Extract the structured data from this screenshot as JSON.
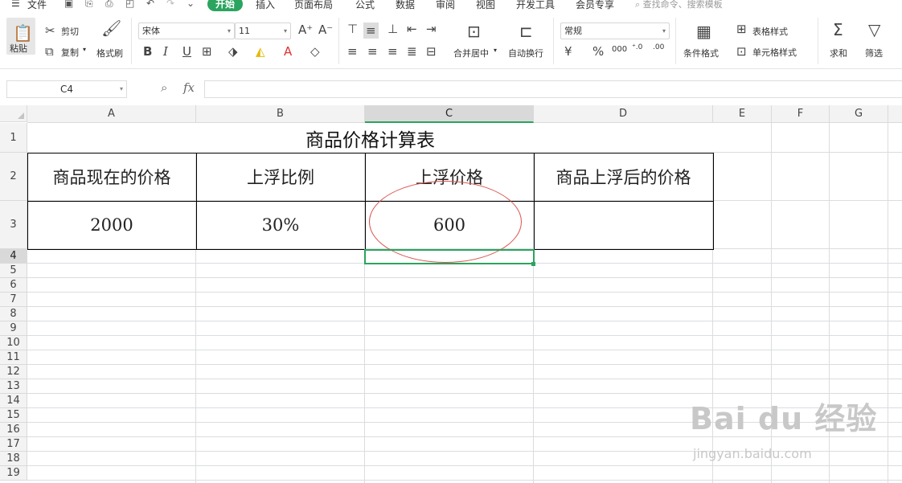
{
  "menu": {
    "file_label": "文件",
    "tabs": [
      {
        "label": "开始",
        "active": true
      },
      {
        "label": "插入"
      },
      {
        "label": "页面布局"
      },
      {
        "label": "公式"
      },
      {
        "label": "数据"
      },
      {
        "label": "审阅"
      },
      {
        "label": "视图"
      },
      {
        "label": "开发工具"
      },
      {
        "label": "会员专享"
      }
    ],
    "search_placeholder": "查找命令、搜索模板"
  },
  "ribbon": {
    "paste": "粘贴",
    "cut": "剪切",
    "copy": "复制",
    "format_painter": "格式刷",
    "font_name": "宋体",
    "font_size": "11",
    "merge_center": "合并居中",
    "wrap_text": "自动换行",
    "number_format": "常规",
    "conditional_format": "条件格式",
    "table_style": "表格样式",
    "cell_style": "单元格样式",
    "sum": "求和",
    "filter": "筛选"
  },
  "formula_bar": {
    "cell_ref": "C4",
    "fx": "fx",
    "formula": ""
  },
  "grid": {
    "columns": [
      "A",
      "B",
      "C",
      "D",
      "E",
      "F",
      "G"
    ],
    "selected_column": "C",
    "rows": [
      "1",
      "2",
      "3",
      "4",
      "5",
      "6",
      "7",
      "8",
      "9",
      "10",
      "11",
      "12",
      "13",
      "14",
      "15",
      "16",
      "17",
      "18",
      "19"
    ],
    "selected_row": "4"
  },
  "table": {
    "title": "商品价格计算表",
    "headers": [
      "商品现在的价格",
      "上浮比例",
      "上浮价格",
      "商品上浮后的价格"
    ],
    "values": [
      "2000",
      "30%",
      "600",
      ""
    ]
  },
  "colors": {
    "accent": "#2aa45f",
    "annotation": "#d9534f"
  },
  "watermark": {
    "brand": "Bai du 经验",
    "url": "jingyan.baidu.com"
  }
}
